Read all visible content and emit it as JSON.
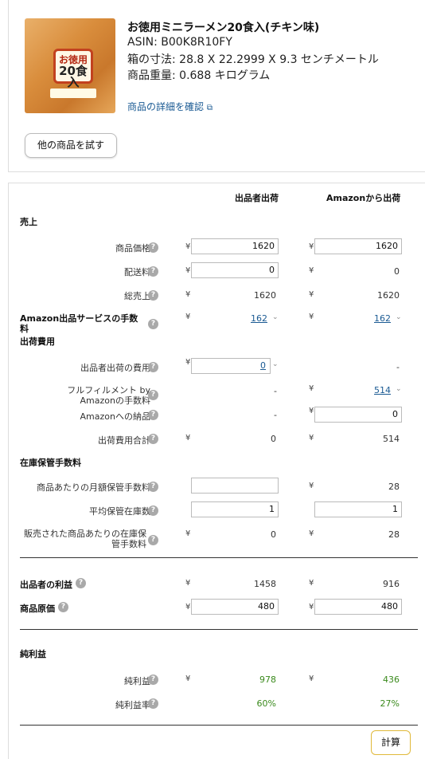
{
  "product": {
    "title": "お徳用ミニラーメン20食入(チキン味)",
    "asin": "ASIN: B00K8R10FY",
    "dimensions": "箱の寸法: 28.8 X 22.2999 X 9.3 センチメートル",
    "weight": "商品重量: 0.688 キログラム",
    "detail_link": "商品の詳細を確認",
    "image_badge_top": "お徳用",
    "image_badge_bottom": "20食入",
    "try_button": "他の商品を試す"
  },
  "columns": {
    "seller": "出品者出荷",
    "amazon": "Amazonから出荷"
  },
  "currency": "¥",
  "help_icon": "?",
  "sections": {
    "sales": "売上",
    "shipping_costs": "出荷費用",
    "storage": "在庫保管手数料",
    "net": "純利益"
  },
  "rows": {
    "price": {
      "label": "商品価格",
      "seller": "1620",
      "amazon": "1620"
    },
    "shipping": {
      "label": "配送料",
      "seller": "0",
      "amazon": "0"
    },
    "total_sales": {
      "label": "総売上",
      "seller": "1620",
      "amazon": "1620"
    },
    "fba_fee": {
      "label": "Amazon出品サービスの手数料",
      "seller": "162",
      "amazon": "162"
    },
    "seller_ship": {
      "label": "出品者出荷の費用",
      "seller": "0",
      "amazon": "-"
    },
    "fulfillment": {
      "label": "フルフィルメント by Amazonの手数料",
      "seller": "-",
      "amazon": "514"
    },
    "inbound": {
      "label": "Amazonへの納品",
      "seller": "-",
      "amazon": "0"
    },
    "ship_total": {
      "label": "出荷費用合計",
      "seller": "0",
      "amazon": "514"
    },
    "monthly_storage": {
      "label": "商品あたりの月額保管手数料",
      "seller": "",
      "amazon": "28"
    },
    "avg_inventory": {
      "label": "平均保管在庫数",
      "seller": "1",
      "amazon": "1"
    },
    "storage_per_sold": {
      "label": "販売された商品あたりの在庫保管手数料",
      "seller": "0",
      "amazon": "28"
    },
    "seller_profit": {
      "label": "出品者の利益",
      "seller": "1458",
      "amazon": "916"
    },
    "cost": {
      "label": "商品原価",
      "seller": "480",
      "amazon": "480"
    },
    "net_profit": {
      "label": "純利益",
      "seller": "978",
      "amazon": "436"
    },
    "net_margin": {
      "label": "純利益率",
      "seller": "60%",
      "amazon": "27%"
    }
  },
  "calc_button": "計算",
  "colors": {
    "link": "#1a5a93",
    "profit_green": "#3a8a1c",
    "button_border": "#e0b93a"
  }
}
